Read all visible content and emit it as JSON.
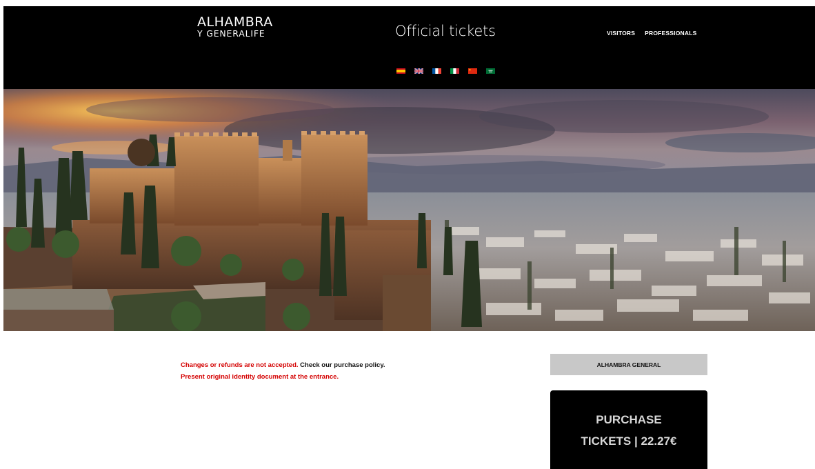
{
  "header": {
    "logo": {
      "line1": "ALHAMBRA",
      "line2": "Y GENERALIFE"
    },
    "title": "Official tickets",
    "nav": [
      {
        "label": "VISITORS"
      },
      {
        "label": "PROFESSIONALS"
      }
    ],
    "languages": [
      {
        "icon": "spain-flag-icon",
        "colors": [
          "#c60b1e",
          "#ffc400",
          "#c60b1e"
        ]
      },
      {
        "icon": "uk-flag-icon",
        "colors": [
          "#012169",
          "#ffffff",
          "#c8102e"
        ]
      },
      {
        "icon": "france-flag-icon",
        "colors": [
          "#0055a4",
          "#ffffff",
          "#ef4135"
        ]
      },
      {
        "icon": "italy-flag-icon",
        "colors": [
          "#009246",
          "#ffffff",
          "#ce2b37"
        ]
      },
      {
        "icon": "china-flag-icon",
        "colors": [
          "#de2910",
          "#ffde00"
        ]
      },
      {
        "icon": "arabic-flag-icon",
        "colors": [
          "#006c35",
          "#ffffff"
        ]
      }
    ]
  },
  "hero": {
    "icon": "alhambra-panorama-image"
  },
  "notice": {
    "refunds": "Changes or refunds are not accepted.",
    "check_prefix": "Check our",
    "policy_link": "purchase policy.",
    "identity": "Present original identity document at the entrance."
  },
  "ticket": {
    "product_tab": "ALHAMBRA GENERAL",
    "purchase_line1": "PURCHASE",
    "purchase_line2": "TICKETS | 22.27€"
  },
  "colors": {
    "header_bg": "#000000",
    "notice_red": "#d40000",
    "tab_bg": "#c8c8c8",
    "button_bg": "#000000",
    "button_text": "#d8d8d8"
  }
}
